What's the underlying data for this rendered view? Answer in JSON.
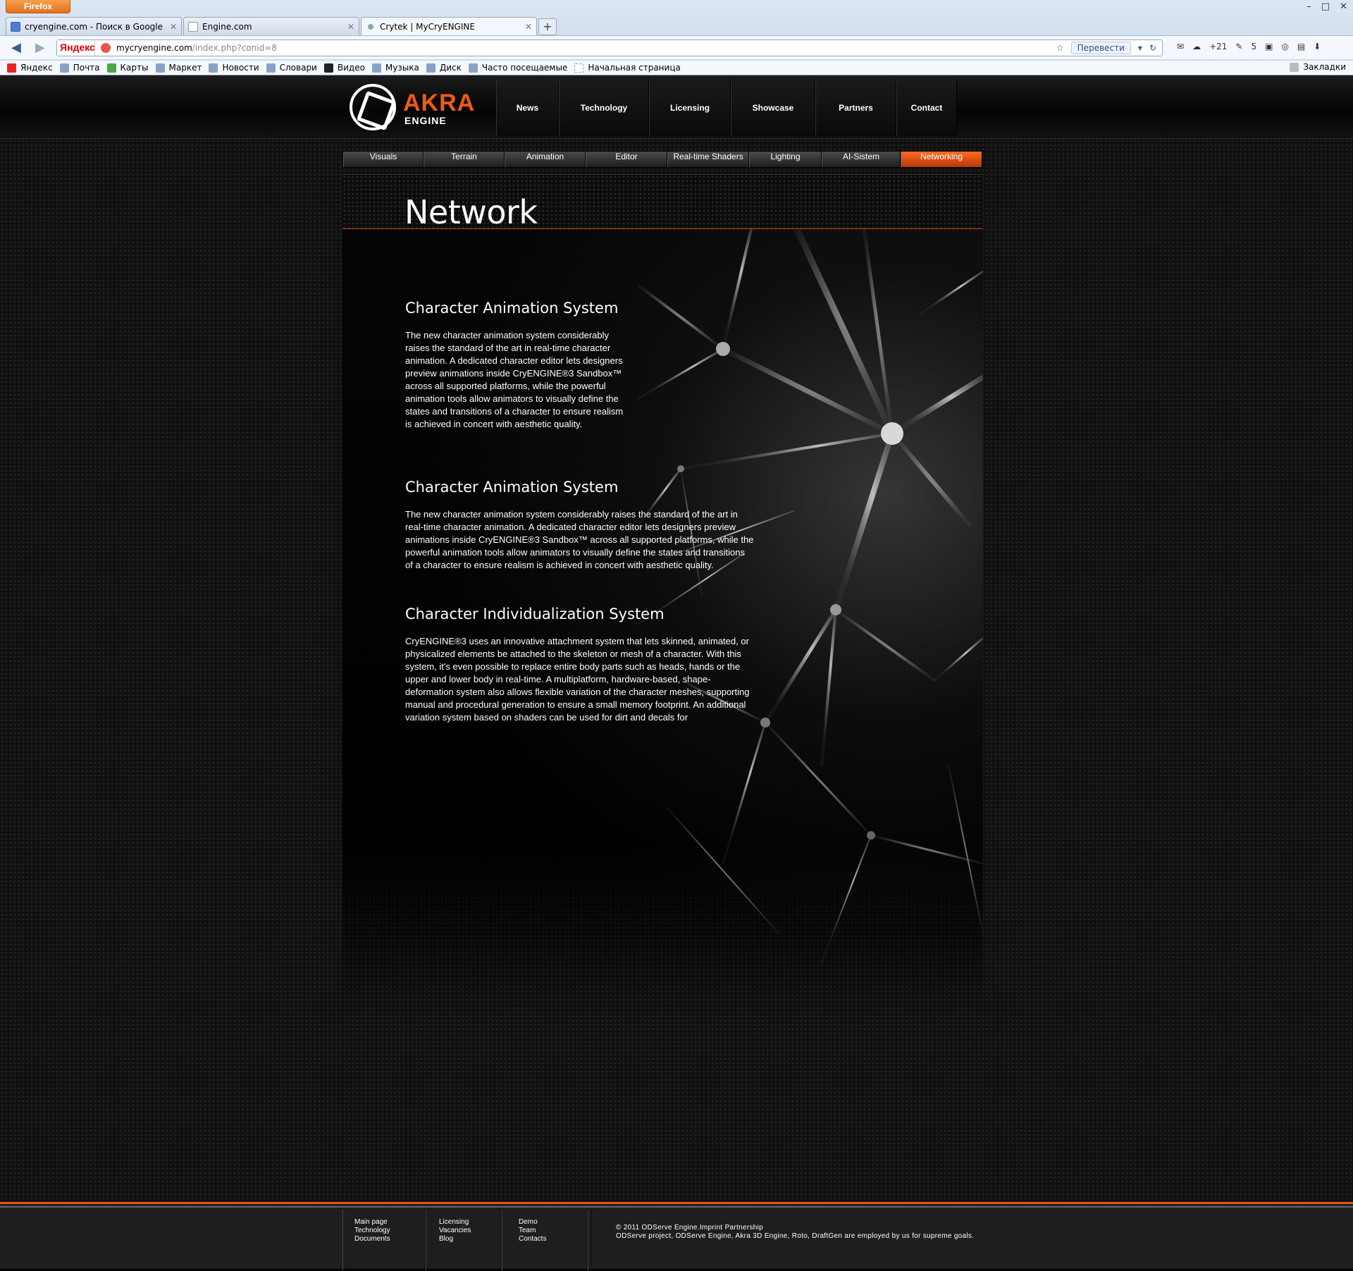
{
  "browser": {
    "menu_button": "Firefox",
    "tabs": [
      {
        "title": "cryengine.com - Поиск в Google"
      },
      {
        "title": "Engine.com"
      },
      {
        "title": "Crytek | MyCryENGINE"
      }
    ],
    "new_tab": "+",
    "url_host": "mycryengine.com",
    "url_path": "/index.php?conid=8",
    "search_engine_logo": "Яндекс",
    "translate_button": "Перевести",
    "toolbar": {
      "weather": "+21",
      "mail_count": "5"
    },
    "bookmarks": [
      {
        "label": "Яндекс"
      },
      {
        "label": "Почта"
      },
      {
        "label": "Карты"
      },
      {
        "label": "Маркет"
      },
      {
        "label": "Новости"
      },
      {
        "label": "Словари"
      },
      {
        "label": "Видео"
      },
      {
        "label": "Музыка"
      },
      {
        "label": "Диск"
      },
      {
        "label": "Часто посещаемые"
      },
      {
        "label": "Начальная страница"
      }
    ],
    "bookmarks_menu": "Закладки"
  },
  "site": {
    "logo": {
      "brand": "AKRA",
      "sub": "ENGINE"
    },
    "topnav": [
      {
        "label": "News"
      },
      {
        "label": "Technology"
      },
      {
        "label": "Licensing"
      },
      {
        "label": "Showcase"
      },
      {
        "label": "Partners"
      },
      {
        "label": "Contact"
      }
    ],
    "subnav": [
      {
        "label": "Visuals"
      },
      {
        "label": "Terrain"
      },
      {
        "label": "Animation"
      },
      {
        "label": "Editor"
      },
      {
        "label": "Real-time  Shaders"
      },
      {
        "label": "Lighting"
      },
      {
        "label": "AI-Sistem"
      },
      {
        "label": "Networking",
        "active": true
      }
    ],
    "page_title": "Network",
    "sections": [
      {
        "heading": "Character Animation System",
        "body": "The new character animation system considerably raises the standard of the art in real-time character  animation. A dedicated character editor lets designers preview animations inside CryENGINE®3 Sandbox™ across all supported platforms, while the powerful animation tools allow animators to visually define the states and transitions of a character to ensure realism is achieved in concert with aesthetic quality."
      },
      {
        "heading": "Character Animation System",
        "body": "The new character animation system considerably raises the standard of the art in real-time character animation. A dedicated character editor lets designers preview animations inside CryENGINE®3 Sandbox™ across all supported platforms, while the powerful animation tools allow animators to visually define the states and transitions of a character to ensure realism is achieved in concert with aesthetic quality."
      },
      {
        "heading": "Character Individualization System",
        "body": "CryENGINE®3 uses an innovative attachment system that lets skinned, animated, or physicalized elements be attached to the skeleton or mesh of a character. With this system, it's even possible to replace entire body parts such as heads, hands or the upper and lower body in real-time. A multiplatform, hardware-based, shape-deformation system also allows flexible variation of the character meshes, supporting manual and procedural generation to ensure a small memory footprint. An additional variation system based on shaders can be used for dirt and decals for"
      }
    ],
    "footer": {
      "col1": [
        "Main page",
        "Technology",
        "Documents"
      ],
      "col2": [
        "Licensing",
        "Vacancies",
        "Blog"
      ],
      "col3": [
        "Demo",
        "Team",
        "Contacts"
      ],
      "copyright": "© 2011 ODServe Engine.Imprint Partnership",
      "notice": "ODServe project, ODServe Engine, Akra 3D Engine, Roto, DraftGen are employed by us for supreme goals."
    },
    "colors": {
      "accent": "#f05a14",
      "background": "#000000"
    }
  }
}
